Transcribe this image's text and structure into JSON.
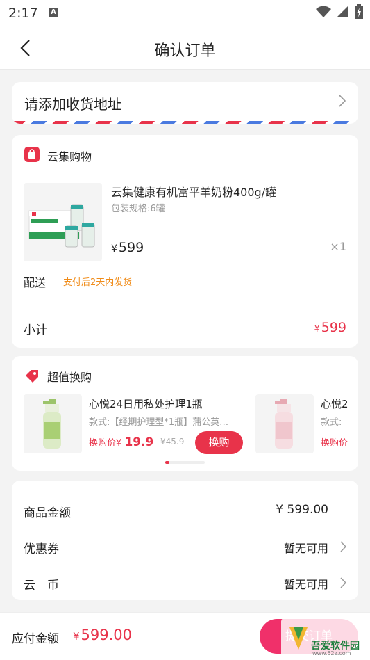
{
  "status_bar": {
    "time": "2:17",
    "a_badge": "A"
  },
  "nav": {
    "title": "确认订单"
  },
  "address": {
    "label": "请添加收货地址"
  },
  "store": {
    "shop_name": "云集购物",
    "product_name": "云集健康有机富平羊奶粉400g/罐",
    "spec": "包装规格:6罐",
    "currency": "¥",
    "price": "599",
    "qty": "×1",
    "shipping_label": "配送",
    "shipping_value": "支付后2天内发货",
    "subtotal_label": "小计",
    "subtotal_value": "599"
  },
  "exchange": {
    "title": "超值换购",
    "items": [
      {
        "name": "心悦24日用私处护理1瓶",
        "style": "款式:【经期护理型*1瓶】蒲公英…",
        "price_label": "换购价",
        "currency": "¥",
        "price": "19.9",
        "old_price": "¥45.9",
        "button": "换购"
      },
      {
        "name": "心悦2",
        "style": "款式:",
        "price_label": "换购价"
      }
    ]
  },
  "summary": {
    "goods_label": "商品金额",
    "goods_value": "¥ 599.00",
    "coupon_label": "优惠券",
    "coupon_value": "暂无可用",
    "coin_label": "云　币",
    "coin_value": "暂无可用"
  },
  "bottom": {
    "pay_label": "应付金额",
    "currency": "¥",
    "pay_value": "599.00",
    "submit": "提交订单"
  },
  "watermark": {
    "text": "吾爱软件园",
    "sub": "www.52z.com"
  },
  "colors": {
    "accent": "#e8334a",
    "submit": "#f0306a",
    "shipping": "#f08c1a"
  }
}
